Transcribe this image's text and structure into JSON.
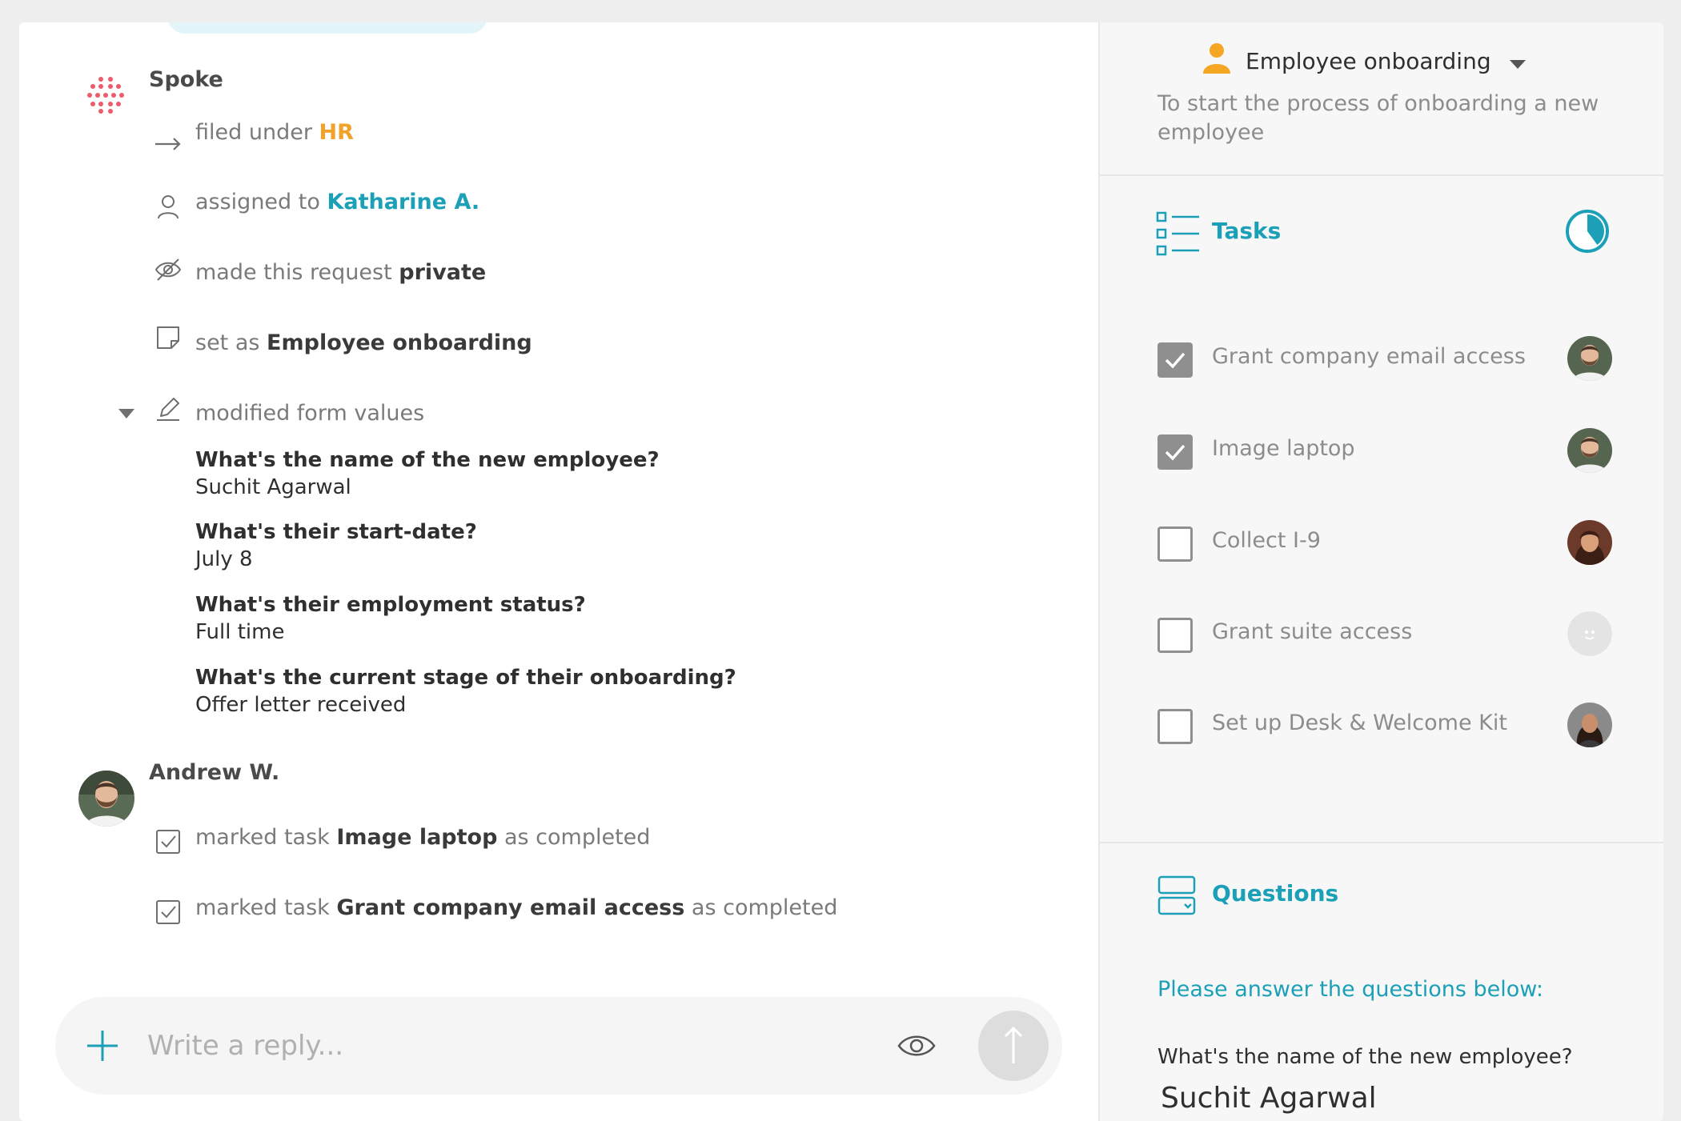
{
  "feed": {
    "events": [
      {
        "author": "Spoke",
        "actions": [
          {
            "icon": "arrow-right-icon",
            "prefix": "filed under ",
            "strong": "HR",
            "suffix": ""
          },
          {
            "icon": "person-icon",
            "prefix": "assigned to ",
            "strong": "Katharine A.",
            "suffix": ""
          },
          {
            "icon": "eye-hidden-icon",
            "prefix": "made this request ",
            "strong": "private",
            "suffix": ""
          },
          {
            "icon": "note-icon",
            "prefix": "set as ",
            "strong": "Employee onboarding",
            "suffix": ""
          },
          {
            "icon": "edit-icon",
            "prefix": "modified form values",
            "strong": "",
            "suffix": ""
          }
        ],
        "form_values": [
          {
            "question": "What's the name of the new employee?",
            "answer": "Suchit Agarwal"
          },
          {
            "question": "What's their start-date?",
            "answer": "July 8"
          },
          {
            "question": "What's their employment status?",
            "answer": "Full time"
          },
          {
            "question": "What's the current stage of their onboarding?",
            "answer": "Offer letter received"
          }
        ]
      },
      {
        "author": "Andrew W.",
        "actions": [
          {
            "icon": "checkbox-icon",
            "prefix": "marked task ",
            "strong": "Image laptop",
            "suffix": " as completed"
          },
          {
            "icon": "checkbox-icon",
            "prefix": "marked task ",
            "strong": "Grant company email access",
            "suffix": " as completed"
          }
        ]
      }
    ]
  },
  "reply": {
    "placeholder": "Write a reply...",
    "add_icon": "plus-icon",
    "visibility_icon": "eye-icon",
    "send_icon": "arrow-up-icon"
  },
  "panel": {
    "request_type": "Employee onboarding",
    "description": "To start the process of onboarding a new employee",
    "tasks": {
      "heading": "Tasks",
      "progress": 0.4,
      "items": [
        {
          "label": "Grant company email access",
          "checked": true,
          "avatar": "andrew"
        },
        {
          "label": "Image laptop",
          "checked": true,
          "avatar": "andrew"
        },
        {
          "label": "Collect I-9",
          "checked": false,
          "avatar": "woman1"
        },
        {
          "label": "Grant suite access",
          "checked": false,
          "avatar": "placeholder"
        },
        {
          "label": "Set up Desk & Welcome Kit",
          "checked": false,
          "avatar": "woman2"
        }
      ]
    },
    "questions": {
      "heading": "Questions",
      "prompt": "Please answer the questions below:",
      "first_question": "What's the name of the new employee?",
      "first_answer": "Suchit Agarwal"
    }
  },
  "colors": {
    "accent": "#1ba0b8",
    "category": "#f0a22a",
    "spoke_logo": "#ef5b6a"
  }
}
